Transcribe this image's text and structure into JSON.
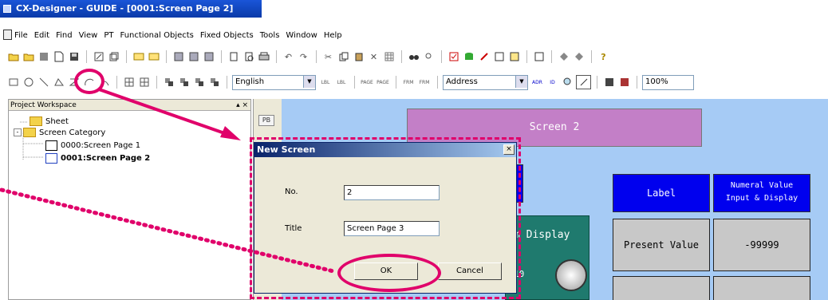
{
  "window": {
    "title": "CX-Designer - GUIDE - [0001:Screen Page 2]"
  },
  "menubar": {
    "items": [
      "File",
      "Edit",
      "Find",
      "View",
      "PT",
      "Functional Objects",
      "Fixed Objects",
      "Tools",
      "Window",
      "Help"
    ]
  },
  "toolbar2": {
    "language": "English",
    "address": "Address",
    "zoom": "100%",
    "buttons": {
      "lbl": "LBL",
      "page": "PAGE",
      "frm": "FRM",
      "adr": "ADR",
      "id": "ID"
    }
  },
  "workspace": {
    "title": "Project Workspace",
    "controls": "▴ ×",
    "tree": {
      "sheet": "Sheet",
      "category": "Screen Category",
      "pages": [
        "0000:Screen Page 1",
        "0001:Screen Page 2"
      ]
    }
  },
  "sidestrip": {
    "pb": "PB"
  },
  "canvas": {
    "screen_title": "Screen 2",
    "label_header": "Label",
    "numeral_header_line1": "Numeral Value",
    "numeral_header_line2": "Input & Display",
    "present_value": "Present Value",
    "value": "-99999",
    "partial_text": "m Display",
    "partial_zero": "10"
  },
  "dialog": {
    "title": "New Screen",
    "close": "×",
    "no_label": "No.",
    "no_value": "2",
    "title_label": "Title",
    "title_value": "Screen Page 3",
    "ok_label": "OK",
    "cancel_label": "Cancel"
  },
  "colors": {
    "annotation": "#e0006a",
    "canvas": "#a6cbf5",
    "screen_title_bg": "#c37fc7",
    "label_bg": "#0000ee"
  }
}
